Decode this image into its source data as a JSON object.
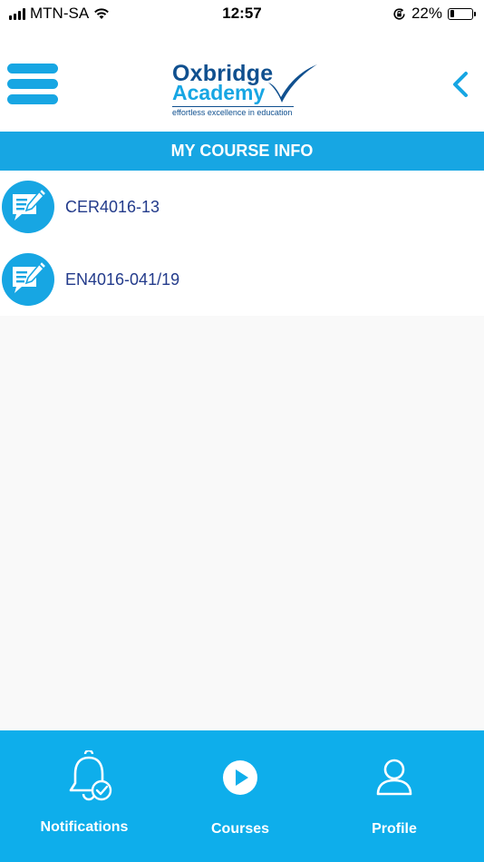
{
  "status_bar": {
    "carrier": "MTN-SA",
    "time": "12:57",
    "battery_percent": "22%",
    "battery_level": 0.22,
    "icons": [
      "signal-icon",
      "wifi-icon",
      "orientation-lock-icon",
      "battery-icon"
    ]
  },
  "header": {
    "logo": {
      "line1": "Oxbridge",
      "line2": "Academy",
      "tagline": "effortless excellence in education"
    },
    "menu_icon": "hamburger-icon",
    "back_icon": "chevron-left-icon"
  },
  "page": {
    "title": "MY COURSE INFO"
  },
  "courses": [
    {
      "code": "CER4016-13",
      "icon": "course-document-icon"
    },
    {
      "code": "EN4016-041/19",
      "icon": "course-document-icon"
    }
  ],
  "tabs": [
    {
      "label": "Notifications",
      "icon": "bell-check-icon"
    },
    {
      "label": "Courses",
      "icon": "play-circle-icon"
    },
    {
      "label": "Profile",
      "icon": "user-icon"
    }
  ],
  "colors": {
    "brand_blue": "#17a6e3",
    "brand_navy": "#10508f",
    "tab_bar": "#0eaeeb",
    "course_text": "#233b8b"
  }
}
